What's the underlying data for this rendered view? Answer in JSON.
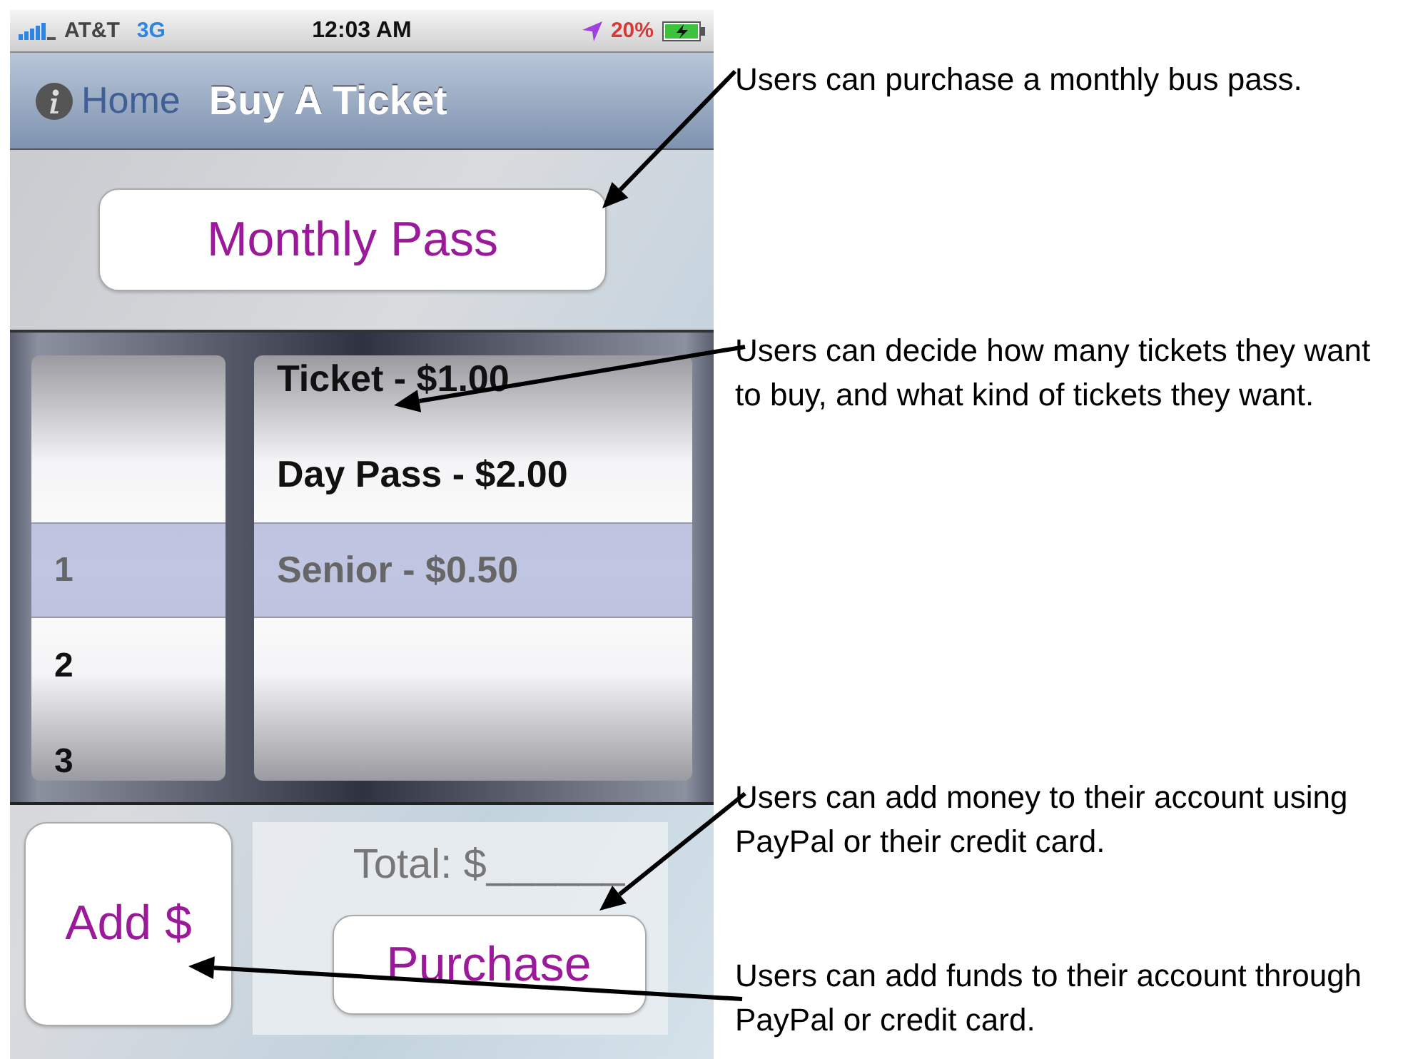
{
  "status_bar": {
    "carrier": "AT&T",
    "network": "3G",
    "time": "12:03 AM",
    "battery": "20%"
  },
  "nav_bar": {
    "back": "Home",
    "title": "Buy A Ticket"
  },
  "pass_button": "Monthly Pass",
  "picker": {
    "quantity": [
      {
        "label": "1",
        "selected": true
      },
      {
        "label": "2",
        "selected": false
      },
      {
        "label": "3",
        "selected": false
      }
    ],
    "ticket_type": [
      {
        "label": "Ticket - $1.00",
        "selected": false
      },
      {
        "label": "Day Pass - $2.00",
        "selected": false
      },
      {
        "label": "Senior - $0.50",
        "selected": true
      }
    ]
  },
  "total": "Total: $______",
  "add_funds_button": "Add $",
  "purchase_button": "Purchase",
  "annotations": [
    {
      "text": "Users can purchase a monthly bus pass."
    },
    {
      "text": "Users can decide how many tickets they want to buy, and what kind of tickets they want."
    },
    {
      "text": "Users can add money to their account using PayPal or their credit card."
    },
    {
      "text": "Users can add funds to their account through PayPal or credit card."
    }
  ]
}
